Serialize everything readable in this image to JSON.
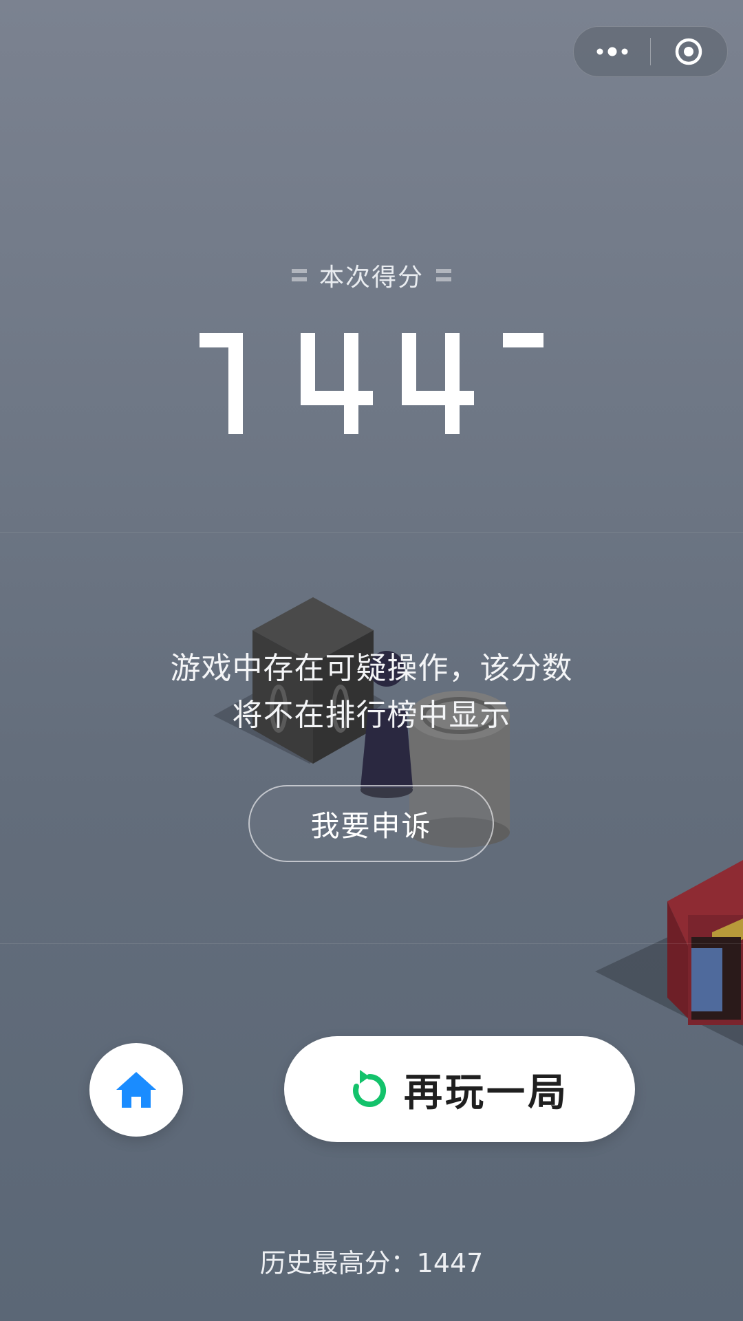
{
  "capsule": {
    "more_icon": "more-dots-icon",
    "close_icon": "target-circle-icon"
  },
  "score": {
    "label": "本次得分",
    "value": "1447"
  },
  "warning": {
    "line1": "游戏中存在可疑操作，该分数",
    "line2": "将不在排行榜中显示"
  },
  "appeal_button": "我要申诉",
  "actions": {
    "home_icon": "home-icon",
    "replay_icon": "replay-arrow-icon",
    "replay_label": "再玩一局"
  },
  "best": {
    "text": "历史最高分：1447"
  },
  "colors": {
    "accent_blue": "#1a8cff",
    "accent_green": "#13c26b"
  }
}
